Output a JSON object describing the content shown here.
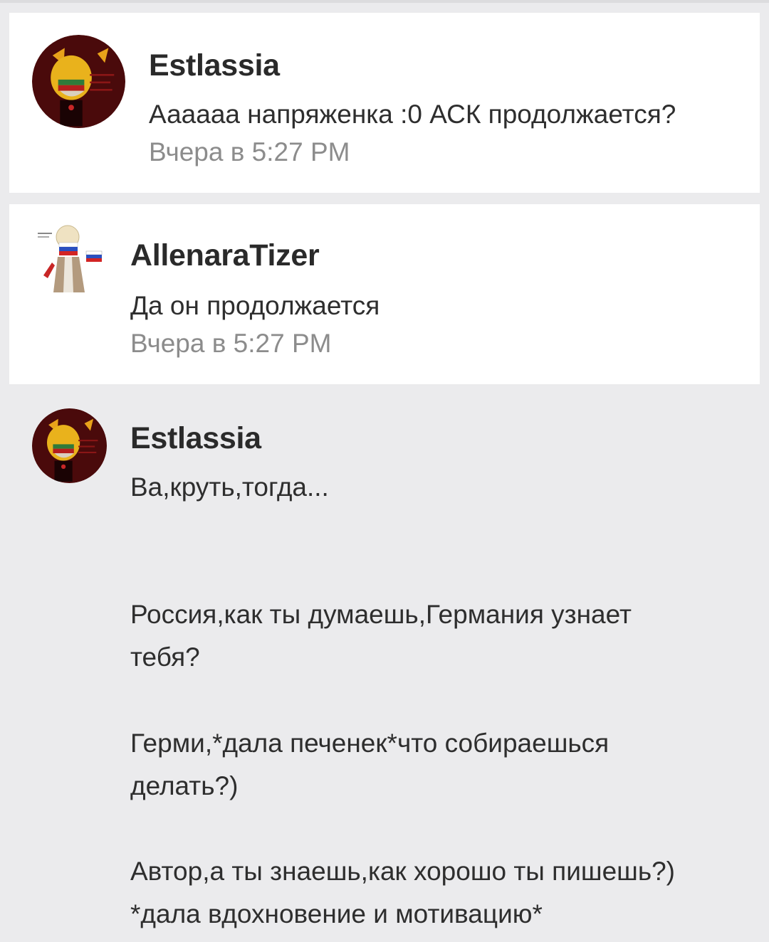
{
  "comments": [
    {
      "author": "Estlassia",
      "text": "Аааааа напряженка :0 АСК продолжается?",
      "time": "Вчера в 5:27 PM"
    },
    {
      "author": "AllenaraTizer",
      "text": "Да он продолжается",
      "time": "Вчера в 5:27 PM"
    },
    {
      "author": "Estlassia",
      "lines": [
        "Ва,круть,тогда...",
        "Россия,как ты думаешь,Германия узнает",
        "тебя?",
        "Герми,*дала печенек*что собираешься",
        "делать?)",
        "Автор,а ты знаешь,как хорошо ты пишешь?)",
        "*дала вдохновение и мотивацию*"
      ]
    }
  ],
  "colors": {
    "background": "#ebebed",
    "card": "#ffffff",
    "author": "#2a2a2a",
    "time": "#8c8c8c"
  }
}
